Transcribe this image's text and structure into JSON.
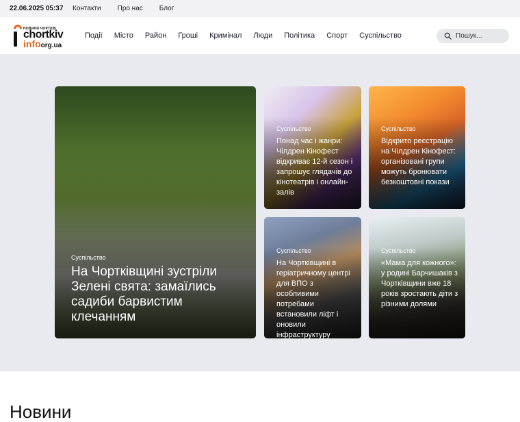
{
  "topbar": {
    "datetime": "22.06.2025 05:37",
    "links": [
      "Контакти",
      "Про нас",
      "Блог"
    ]
  },
  "logo": {
    "line1": "НОВИНИ ЧОРТКІВ",
    "line2": "chortkiv",
    "line3": "info",
    "line3_suffix": "org.ua"
  },
  "nav": [
    "Події",
    "Місто",
    "Район",
    "Гроші",
    "Кримінал",
    "Люди",
    "Політика",
    "Спорт",
    "Суспільство"
  ],
  "search": {
    "placeholder": "Пошук..."
  },
  "featured": {
    "category": "Суспільство",
    "title": "На Чортківщині зустріли Зелені свята: замаїлись садиби барвистим клечанням"
  },
  "cards": [
    {
      "category": "Суспільство",
      "title": "Понад час і жанри: Чілдрен Кінофест відкриває 12-й сезон і запрошує глядачів до кінотеатрів і онлайн-залів"
    },
    {
      "category": "Суспільство",
      "title": "Відкрито реєстрацію на Чілдрен Кінофест: організовані групи можуть бронювати безкоштовні покази"
    },
    {
      "category": "Суспільство",
      "title": "На Чортківщині в геріатричному центрі для ВПО з особливими потребами встановили ліфт і оновили інфраструктуру"
    },
    {
      "category": "Суспільство",
      "title": "«Мама для кожного»: у родині Барчишаків з Чортківщини вже 18 років зростають діти з різними долями"
    }
  ],
  "section": {
    "heading": "Новини"
  },
  "colors": {
    "accent": "#e8651a",
    "hero_bg": "#e8eaef",
    "topbar_bg": "#f2f2f4"
  }
}
